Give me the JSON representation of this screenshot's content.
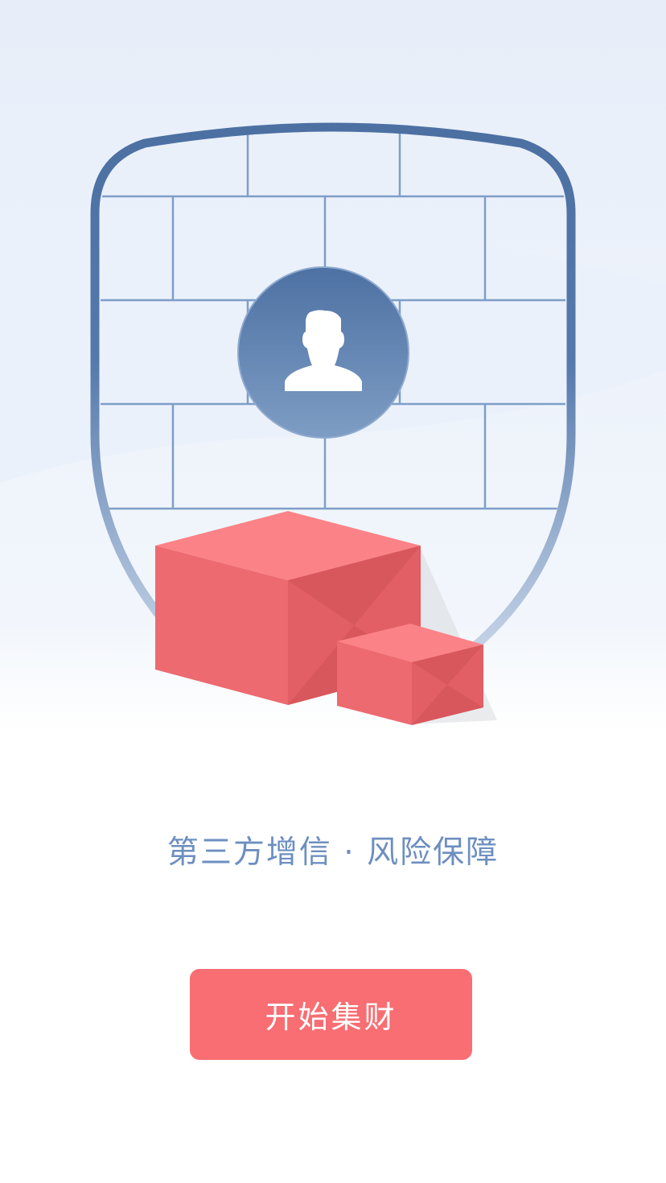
{
  "intro": {
    "tagline": "第三方增信 · 风险保障",
    "start_button_label": "开始集财"
  },
  "illustration": {
    "shield_icon": "shield-brick-wall-icon",
    "avatar_icon": "person-silhouette-icon",
    "box_icons": [
      "large-red-box-icon",
      "small-red-box-icon"
    ]
  },
  "colors": {
    "background_top": "#e8eef9",
    "shield_outline": "#4d72a5",
    "avatar_circle": "#5b7fb0",
    "box_red": "#ec6a70",
    "tagline_text": "#6d8fc0",
    "button_bg": "#f86e72",
    "button_text": "#ffffff"
  }
}
